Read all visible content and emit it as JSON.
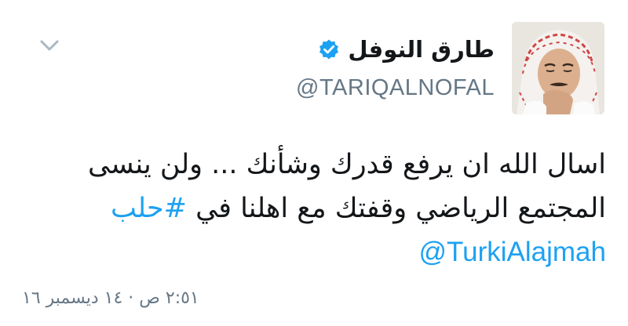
{
  "tweet": {
    "display_name": "طارق النوفل",
    "handle": "@TARIQALNOFAL",
    "verified": true,
    "body_line_1": "اسال الله ان يرفع قدرك وشأنك ... ولن ينسى",
    "body_line_2_text": "المجتمع الرياضي وقفتك مع اهلنا في ",
    "hashtag": "#حلب",
    "mention": "@TurkiAlajmah",
    "timestamp": "٢:٥١ ص · ١٤ ديسمبر ١٦"
  },
  "icons": {
    "avatar": "profile-photo",
    "verified": "verified-badge-icon",
    "menu": "chevron-down-icon"
  },
  "colors": {
    "link": "#1da1f2",
    "secondary_text": "#657786",
    "primary_text": "#14171a"
  }
}
